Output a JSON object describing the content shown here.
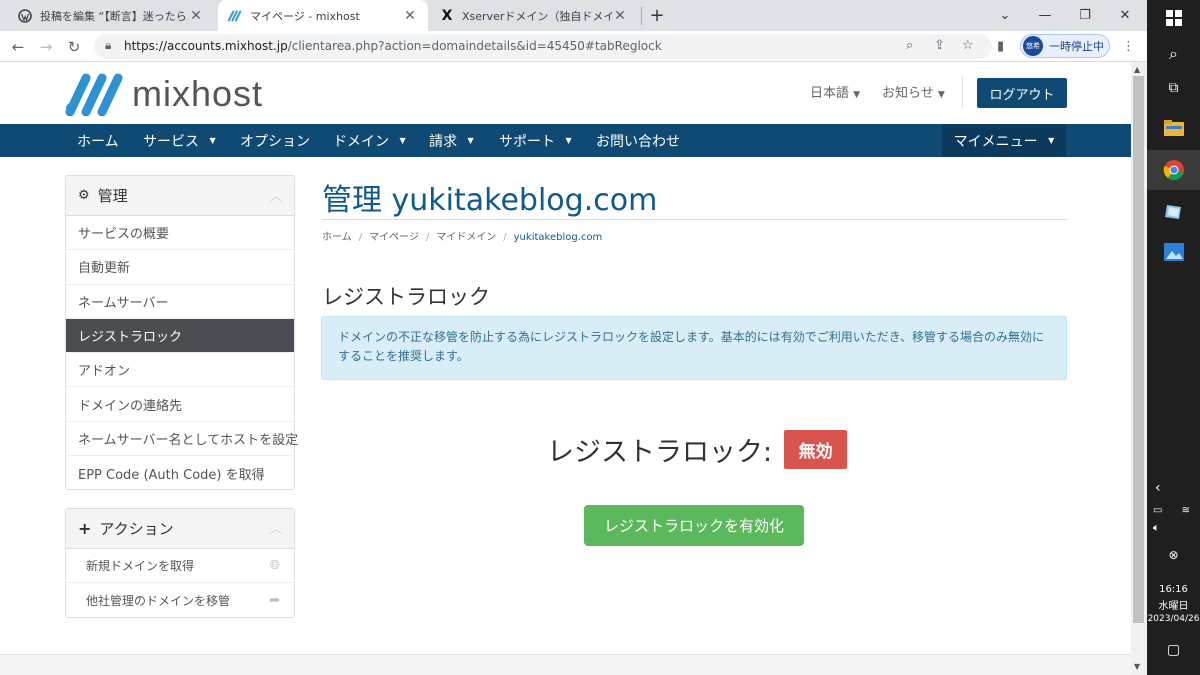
{
  "browser": {
    "tabs": [
      {
        "title": "投稿を編集 “【断言】迷ったらエックス",
        "icon": "wordpress-icon"
      },
      {
        "title": "マイページ - mixhost",
        "icon": "mixhost-icon"
      },
      {
        "title": "Xserverドメイン（独自ドメイン）移管",
        "icon": "x-icon"
      }
    ],
    "new_tab": "+",
    "url_host": "https://accounts.mixhost.jp",
    "url_path": "/clientarea.php?action=domaindetails&id=45450#tabReglock",
    "profile_badge": "悠希",
    "paused_label": "一時停止中"
  },
  "header": {
    "logo_text": "mixhost",
    "language": "日本語",
    "notices": "お知らせ",
    "logout": "ログアウト"
  },
  "nav": {
    "items": [
      "ホーム",
      "サービス",
      "オプション",
      "ドメイン",
      "請求",
      "サポート",
      "お問い合わせ"
    ],
    "my_menu": "マイメニュー"
  },
  "sidebar": {
    "manage_title": "管理",
    "items": [
      "サービスの概要",
      "自動更新",
      "ネームサーバー",
      "レジストラロック",
      "アドオン",
      "ドメインの連絡先",
      "ネームサーバー名としてホストを設定",
      "EPP Code (Auth Code) を取得"
    ],
    "actions_title": "アクション",
    "actions": [
      "新規ドメインを取得",
      "他社管理のドメインを移管"
    ]
  },
  "main": {
    "title": "管理 yukitakeblog.com",
    "breadcrumb": [
      "ホーム",
      "マイページ",
      "マイドメイン",
      "yukitakeblog.com"
    ],
    "section_title": "レジストラロック",
    "info_text": "ドメインの不正な移管を防止する為にレジストラロックを設定します。基本的には有効でご利用いただき、移管する場合のみ無効にすることを推奨します。",
    "lock_label": "レジストラロック:",
    "lock_status": "無効",
    "enable_button": "レジストラロックを有効化"
  },
  "taskbar": {
    "time": "16:16",
    "day": "水曜日",
    "date": "2023/04/26"
  },
  "colors": {
    "nav_bg": "#0f4a74",
    "badge_red": "#d9534f",
    "button_green": "#5cb85c",
    "info_bg": "#d9edf7"
  }
}
